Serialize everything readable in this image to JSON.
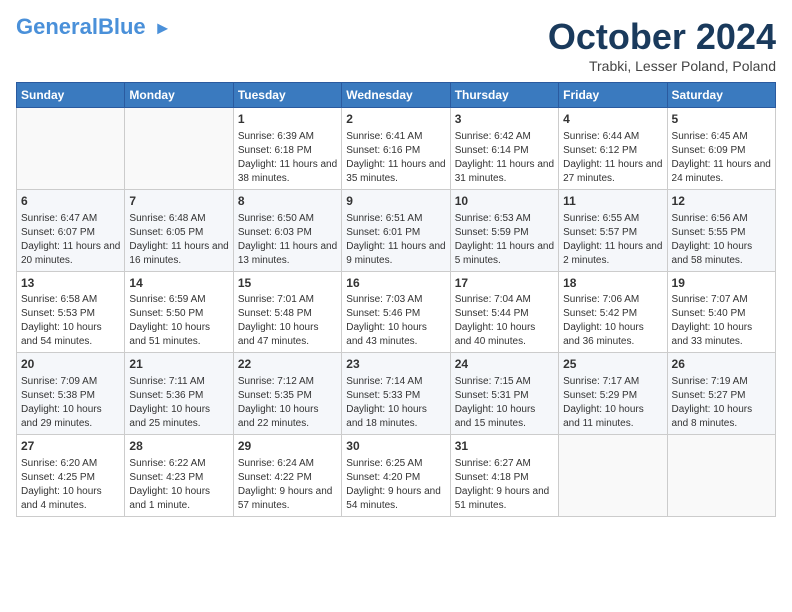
{
  "header": {
    "logo_general": "General",
    "logo_blue": "Blue",
    "month_title": "October 2024",
    "location": "Trabki, Lesser Poland, Poland"
  },
  "days_of_week": [
    "Sunday",
    "Monday",
    "Tuesday",
    "Wednesday",
    "Thursday",
    "Friday",
    "Saturday"
  ],
  "weeks": [
    [
      {
        "day": "",
        "info": ""
      },
      {
        "day": "",
        "info": ""
      },
      {
        "day": "1",
        "info": "Sunrise: 6:39 AM\nSunset: 6:18 PM\nDaylight: 11 hours and 38 minutes."
      },
      {
        "day": "2",
        "info": "Sunrise: 6:41 AM\nSunset: 6:16 PM\nDaylight: 11 hours and 35 minutes."
      },
      {
        "day": "3",
        "info": "Sunrise: 6:42 AM\nSunset: 6:14 PM\nDaylight: 11 hours and 31 minutes."
      },
      {
        "day": "4",
        "info": "Sunrise: 6:44 AM\nSunset: 6:12 PM\nDaylight: 11 hours and 27 minutes."
      },
      {
        "day": "5",
        "info": "Sunrise: 6:45 AM\nSunset: 6:09 PM\nDaylight: 11 hours and 24 minutes."
      }
    ],
    [
      {
        "day": "6",
        "info": "Sunrise: 6:47 AM\nSunset: 6:07 PM\nDaylight: 11 hours and 20 minutes."
      },
      {
        "day": "7",
        "info": "Sunrise: 6:48 AM\nSunset: 6:05 PM\nDaylight: 11 hours and 16 minutes."
      },
      {
        "day": "8",
        "info": "Sunrise: 6:50 AM\nSunset: 6:03 PM\nDaylight: 11 hours and 13 minutes."
      },
      {
        "day": "9",
        "info": "Sunrise: 6:51 AM\nSunset: 6:01 PM\nDaylight: 11 hours and 9 minutes."
      },
      {
        "day": "10",
        "info": "Sunrise: 6:53 AM\nSunset: 5:59 PM\nDaylight: 11 hours and 5 minutes."
      },
      {
        "day": "11",
        "info": "Sunrise: 6:55 AM\nSunset: 5:57 PM\nDaylight: 11 hours and 2 minutes."
      },
      {
        "day": "12",
        "info": "Sunrise: 6:56 AM\nSunset: 5:55 PM\nDaylight: 10 hours and 58 minutes."
      }
    ],
    [
      {
        "day": "13",
        "info": "Sunrise: 6:58 AM\nSunset: 5:53 PM\nDaylight: 10 hours and 54 minutes."
      },
      {
        "day": "14",
        "info": "Sunrise: 6:59 AM\nSunset: 5:50 PM\nDaylight: 10 hours and 51 minutes."
      },
      {
        "day": "15",
        "info": "Sunrise: 7:01 AM\nSunset: 5:48 PM\nDaylight: 10 hours and 47 minutes."
      },
      {
        "day": "16",
        "info": "Sunrise: 7:03 AM\nSunset: 5:46 PM\nDaylight: 10 hours and 43 minutes."
      },
      {
        "day": "17",
        "info": "Sunrise: 7:04 AM\nSunset: 5:44 PM\nDaylight: 10 hours and 40 minutes."
      },
      {
        "day": "18",
        "info": "Sunrise: 7:06 AM\nSunset: 5:42 PM\nDaylight: 10 hours and 36 minutes."
      },
      {
        "day": "19",
        "info": "Sunrise: 7:07 AM\nSunset: 5:40 PM\nDaylight: 10 hours and 33 minutes."
      }
    ],
    [
      {
        "day": "20",
        "info": "Sunrise: 7:09 AM\nSunset: 5:38 PM\nDaylight: 10 hours and 29 minutes."
      },
      {
        "day": "21",
        "info": "Sunrise: 7:11 AM\nSunset: 5:36 PM\nDaylight: 10 hours and 25 minutes."
      },
      {
        "day": "22",
        "info": "Sunrise: 7:12 AM\nSunset: 5:35 PM\nDaylight: 10 hours and 22 minutes."
      },
      {
        "day": "23",
        "info": "Sunrise: 7:14 AM\nSunset: 5:33 PM\nDaylight: 10 hours and 18 minutes."
      },
      {
        "day": "24",
        "info": "Sunrise: 7:15 AM\nSunset: 5:31 PM\nDaylight: 10 hours and 15 minutes."
      },
      {
        "day": "25",
        "info": "Sunrise: 7:17 AM\nSunset: 5:29 PM\nDaylight: 10 hours and 11 minutes."
      },
      {
        "day": "26",
        "info": "Sunrise: 7:19 AM\nSunset: 5:27 PM\nDaylight: 10 hours and 8 minutes."
      }
    ],
    [
      {
        "day": "27",
        "info": "Sunrise: 6:20 AM\nSunset: 4:25 PM\nDaylight: 10 hours and 4 minutes."
      },
      {
        "day": "28",
        "info": "Sunrise: 6:22 AM\nSunset: 4:23 PM\nDaylight: 10 hours and 1 minute."
      },
      {
        "day": "29",
        "info": "Sunrise: 6:24 AM\nSunset: 4:22 PM\nDaylight: 9 hours and 57 minutes."
      },
      {
        "day": "30",
        "info": "Sunrise: 6:25 AM\nSunset: 4:20 PM\nDaylight: 9 hours and 54 minutes."
      },
      {
        "day": "31",
        "info": "Sunrise: 6:27 AM\nSunset: 4:18 PM\nDaylight: 9 hours and 51 minutes."
      },
      {
        "day": "",
        "info": ""
      },
      {
        "day": "",
        "info": ""
      }
    ]
  ]
}
